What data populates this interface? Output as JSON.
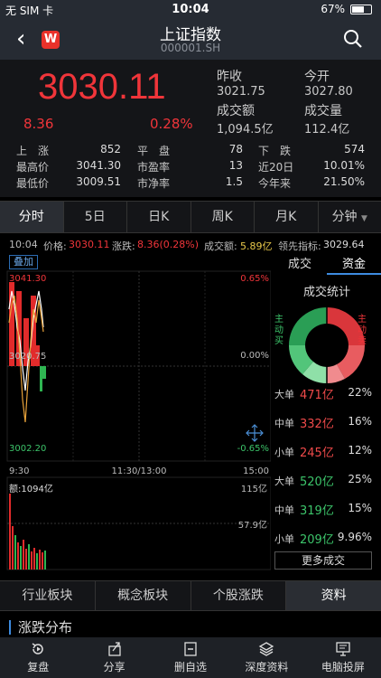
{
  "status": {
    "carrier": "无 SIM 卡",
    "time": "10:04",
    "battery": "67%",
    "battery_level": 0.67
  },
  "nav": {
    "title": "上证指数",
    "code": "000001.SH",
    "logo": "W"
  },
  "quote": {
    "price": "3030.11",
    "change": "8.36",
    "change_pct": "0.28%",
    "prev_close_label": "昨收",
    "prev_close": "3021.75",
    "open_label": "今开",
    "open": "3027.80",
    "turnover_label": "成交额",
    "turnover": "1,094.5亿",
    "volume_label": "成交量",
    "volume": "112.4亿"
  },
  "stats": [
    [
      {
        "label": "上　涨",
        "value": "852"
      },
      {
        "label": "平　盘",
        "value": "78"
      },
      {
        "label": "下　跌",
        "value": "574"
      }
    ],
    [
      {
        "label": "最高价",
        "value": "3041.30"
      },
      {
        "label": "市盈率",
        "value": "13"
      },
      {
        "label": "近20日",
        "value": "10.01%"
      }
    ],
    [
      {
        "label": "最低价",
        "value": "3009.51"
      },
      {
        "label": "市净率",
        "value": "1.5"
      },
      {
        "label": "今年来",
        "value": "21.50%"
      }
    ]
  ],
  "tabs": [
    "分时",
    "5日",
    "日K",
    "周K",
    "月K",
    "分钟"
  ],
  "info": {
    "time": "10:04",
    "price_label": "价格:",
    "price": "3030.11",
    "chg_label": "涨跌:",
    "chg": "8.36(0.28%)",
    "amt_label": "成交额:",
    "amt": "5.89亿",
    "lead_label": "领先指标:",
    "lead": "3029.64"
  },
  "chart": {
    "overlay_label": "叠加",
    "y_top": "3041.30",
    "y_mid": "3020.75",
    "y_bot": "3002.20",
    "pct_top": "0.65%",
    "pct_mid": "0.00%",
    "pct_bot": "-0.65%",
    "t_start": "9:30",
    "t_mid": "11:30/13:00",
    "t_end": "15:00",
    "vol_label": "额:1094亿",
    "vol_top": "115亿",
    "vol_mid": "57.9亿"
  },
  "side": {
    "tab1": "成交",
    "tab2": "资金",
    "title": "成交统计",
    "buy_label": "主动买",
    "sell_label": "主动卖",
    "rows": [
      {
        "name": "大单",
        "amount": "471亿",
        "pct": "22%",
        "color": "#ef4a4a"
      },
      {
        "name": "中单",
        "amount": "332亿",
        "pct": "16%",
        "color": "#ef4a4a"
      },
      {
        "name": "小单",
        "amount": "245亿",
        "pct": "12%",
        "color": "#ef4a4a"
      },
      {
        "name": "大单",
        "amount": "520亿",
        "pct": "25%",
        "color": "#3cc46a"
      },
      {
        "name": "中单",
        "amount": "319亿",
        "pct": "15%",
        "color": "#3cc46a"
      },
      {
        "name": "小单",
        "amount": "209亿",
        "pct": "9.96%",
        "color": "#3cc46a"
      }
    ],
    "more": "更多成交"
  },
  "bottom_tabs": [
    "行业板块",
    "概念板块",
    "个股涨跌",
    "资料"
  ],
  "section_title": "涨跌分布",
  "toolbar": [
    "复盘",
    "分享",
    "删自选",
    "深度资料",
    "电脑投屏"
  ],
  "colors": {
    "up": "#f0353a",
    "down": "#3cc46a",
    "accent": "#3d8be0"
  }
}
